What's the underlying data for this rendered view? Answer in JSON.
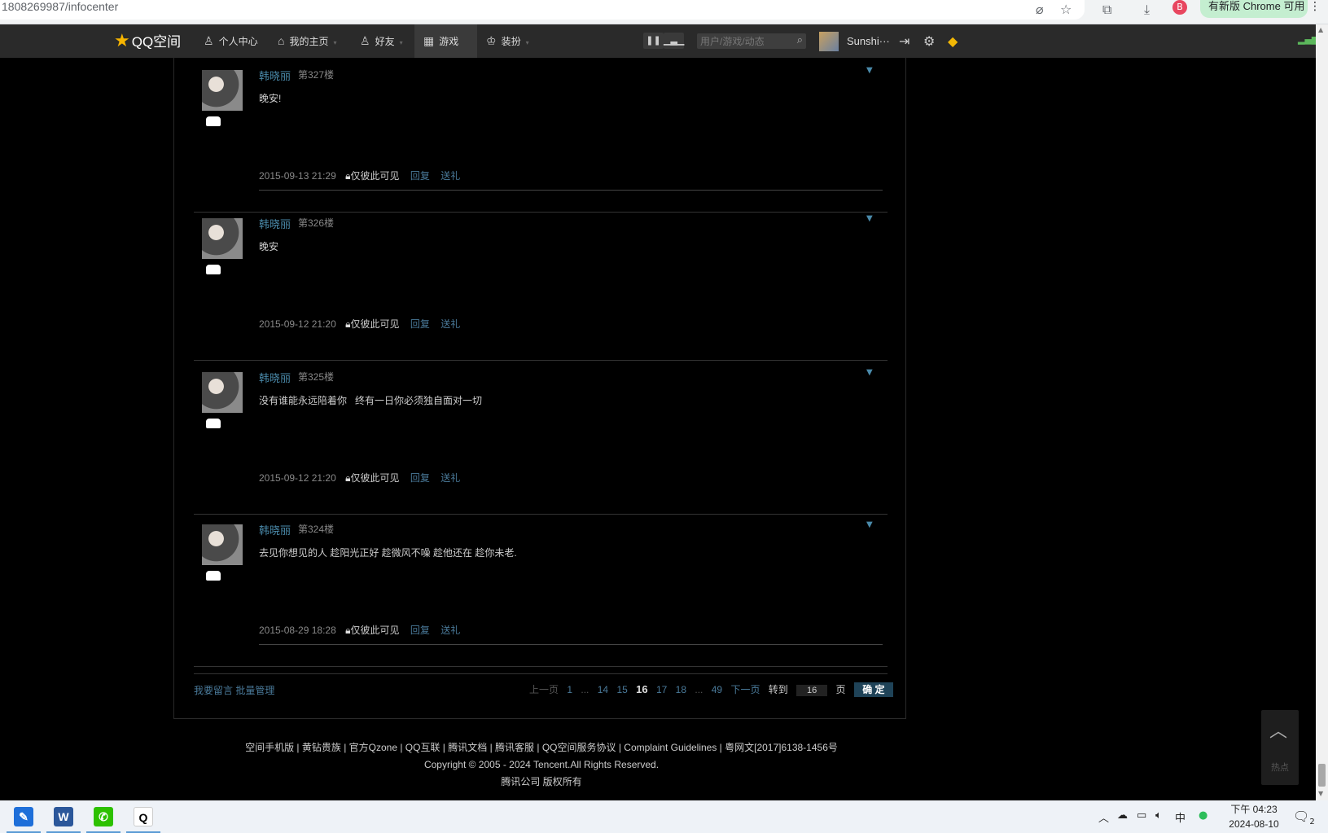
{
  "browser": {
    "url": "1808269987/infocenter",
    "update_label": "有新版 Chrome 可用",
    "profile_initial": "B"
  },
  "nav": {
    "logo": "QQ空间",
    "items": [
      {
        "label": "个人中心",
        "icon": "person-icon"
      },
      {
        "label": "我的主页",
        "icon": "home-icon"
      },
      {
        "label": "好友",
        "icon": "friends-icon"
      },
      {
        "label": "游戏",
        "icon": "grid-icon"
      },
      {
        "label": "装扮",
        "icon": "shirt-icon"
      }
    ],
    "search_placeholder": "用户/游戏/动态",
    "username": "Sunshi···"
  },
  "messages": [
    {
      "author": "韩晓丽",
      "floor": "第327楼",
      "body": "晚安!",
      "time": "2015-09-13 21:29",
      "visibility": "仅彼此可见",
      "reply": "回复",
      "gift": "送礼"
    },
    {
      "author": "韩晓丽",
      "floor": "第326楼",
      "body": "晚安",
      "time": "2015-09-12 21:20",
      "visibility": "仅彼此可见",
      "reply": "回复",
      "gift": "送礼"
    },
    {
      "author": "韩晓丽",
      "floor": "第325楼",
      "body": "没有谁能永远陪着你   终有一日你必须独自面对一切",
      "time": "2015-09-12 21:20",
      "visibility": "仅彼此可见",
      "reply": "回复",
      "gift": "送礼"
    },
    {
      "author": "韩晓丽",
      "floor": "第324楼",
      "body": "去见你想见的人 趁阳光正好 趁微风不噪 趁他还在 趁你未老.",
      "time": "2015-08-29 18:28",
      "visibility": "仅彼此可见",
      "reply": "回复",
      "gift": "送礼"
    }
  ],
  "actions": {
    "leave_message": "我要留言",
    "batch": "批量管理"
  },
  "pager": {
    "prev": "上一页",
    "pages": [
      "1",
      "...",
      "14",
      "15",
      "16",
      "17",
      "18",
      "...",
      "49"
    ],
    "current": "16",
    "next": "下一页",
    "goto": "转到",
    "goto_value": "16",
    "page_unit": "页",
    "confirm": "确 定"
  },
  "footer": {
    "links": "空间手机版 | 黄钻贵族 | 官方Qzone | QQ互联 | 腾讯文档 | 腾讯客服 | QQ空间服务协议 | Complaint Guidelines | 粤网文[2017]6138-1456号",
    "copyright": "Copyright © 2005 - 2024 Tencent.All Rights Reserved.",
    "company": "腾讯公司 版权所有"
  },
  "back_top": {
    "label": "热点"
  },
  "taskbar": {
    "time": "下午 04:23",
    "date": "2024-08-10",
    "ime": "中",
    "notif_count": "2"
  }
}
